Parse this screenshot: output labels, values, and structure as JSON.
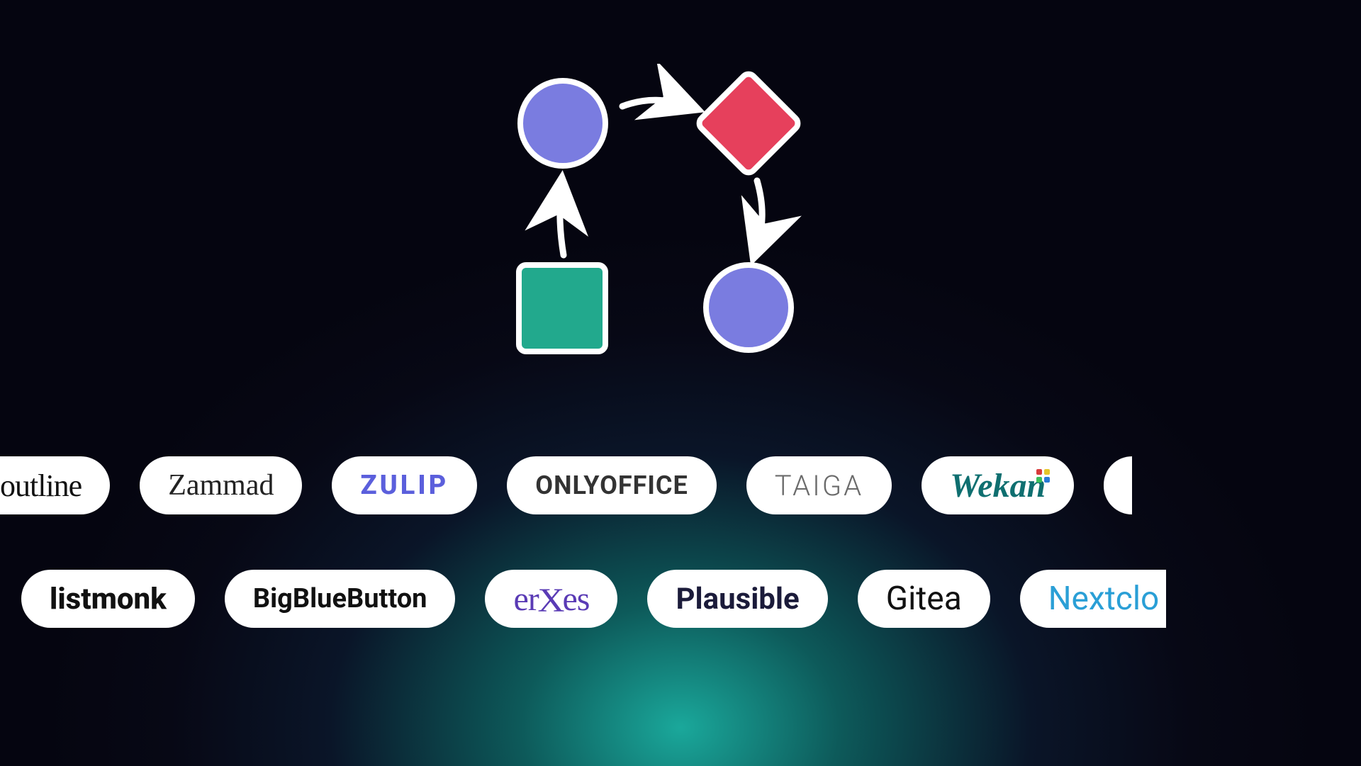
{
  "diagram": {
    "shapes": [
      "circle",
      "diamond",
      "square",
      "circle"
    ],
    "colors": {
      "circle": "#7a7ce0",
      "diamond": "#e6405c",
      "square": "#22a98d"
    }
  },
  "row1": [
    {
      "name": "outline",
      "label": "outline"
    },
    {
      "name": "zammad",
      "label": "Zammad"
    },
    {
      "name": "zulip",
      "label": "ZULIP"
    },
    {
      "name": "onlyoffice",
      "label": "ONLYOFFICE"
    },
    {
      "name": "taiga",
      "label": "TAIGA"
    },
    {
      "name": "wekan",
      "label": "Wekan"
    }
  ],
  "row2": [
    {
      "name": "listmonk",
      "label": "listmonk"
    },
    {
      "name": "bigbluebutton",
      "label": "BigBlueButton"
    },
    {
      "name": "erxes",
      "label": "erxes"
    },
    {
      "name": "plausible",
      "label": "Plausible"
    },
    {
      "name": "gitea",
      "label": "Gitea"
    },
    {
      "name": "nextcloud",
      "label": "Nextclo"
    }
  ]
}
